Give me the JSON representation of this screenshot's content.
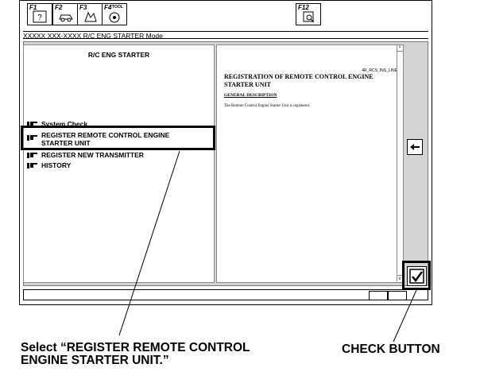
{
  "toolbar": {
    "function_keys": [
      {
        "label": "F1",
        "icon": "help-icon"
      },
      {
        "label": "F2",
        "icon": "car-icon"
      },
      {
        "label": "F3",
        "icon": "hand-tool-icon"
      },
      {
        "label": "F4",
        "icon": "tool-icon",
        "badge": "TOOL"
      },
      {
        "label": "F12",
        "icon": "print-icon"
      }
    ]
  },
  "mode_bar": {
    "text": "XXXXX XXX-XXXX R/C ENG STARTER Mode"
  },
  "left_panel": {
    "title": "R/C ENG STARTER",
    "menu_items": [
      {
        "label": "System Check"
      },
      {
        "label": "REGISTER REMOTE CONTROL ENGINE STARTER UNIT"
      },
      {
        "label": "REGISTER NEW TRANSMITTER"
      },
      {
        "label": "HISTORY"
      }
    ]
  },
  "right_panel": {
    "doc_id": "4R_RCS_INS_LINE",
    "title": "REGISTRATION OF REMOTE CONTROL ENGINE STARTER UNIT",
    "section_heading": "GENERAL DESCRIPTION",
    "body_text": "The Remote Control Engine Starter Unit is registered."
  },
  "scrollbar": {
    "up": "^",
    "down": "v"
  },
  "callouts": {
    "left": "Select “REGISTER REMOTE CONTROL ENGINE STARTER UNIT.”",
    "right": "CHECK BUTTON"
  }
}
